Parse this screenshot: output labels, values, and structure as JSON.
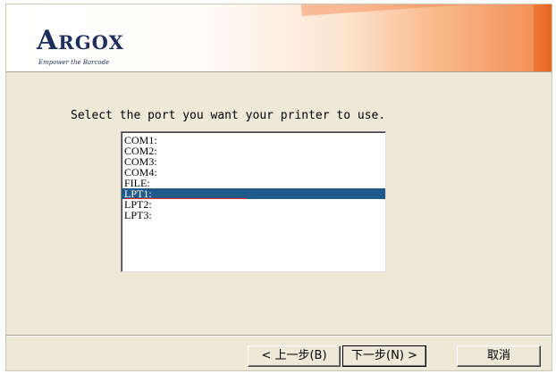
{
  "brand": {
    "logo_initial": "A",
    "logo_rest": "RGOX",
    "tagline": "Empower the Barcode"
  },
  "instruction": "Select the port you want your printer to use.",
  "ports": [
    {
      "label": "COM1:",
      "selected": false
    },
    {
      "label": "COM2:",
      "selected": false
    },
    {
      "label": "COM3:",
      "selected": false
    },
    {
      "label": "COM4:",
      "selected": false
    },
    {
      "label": "FILE:",
      "selected": false
    },
    {
      "label": "LPT1:",
      "selected": true
    },
    {
      "label": "LPT2:",
      "selected": false
    },
    {
      "label": "LPT3:",
      "selected": false
    }
  ],
  "buttons": {
    "back": "< 上一步(B)",
    "next": "下一步(N) >",
    "cancel": "取消"
  },
  "colors": {
    "selection": "#1f5a8a",
    "banner_accent": "#f28a52"
  }
}
